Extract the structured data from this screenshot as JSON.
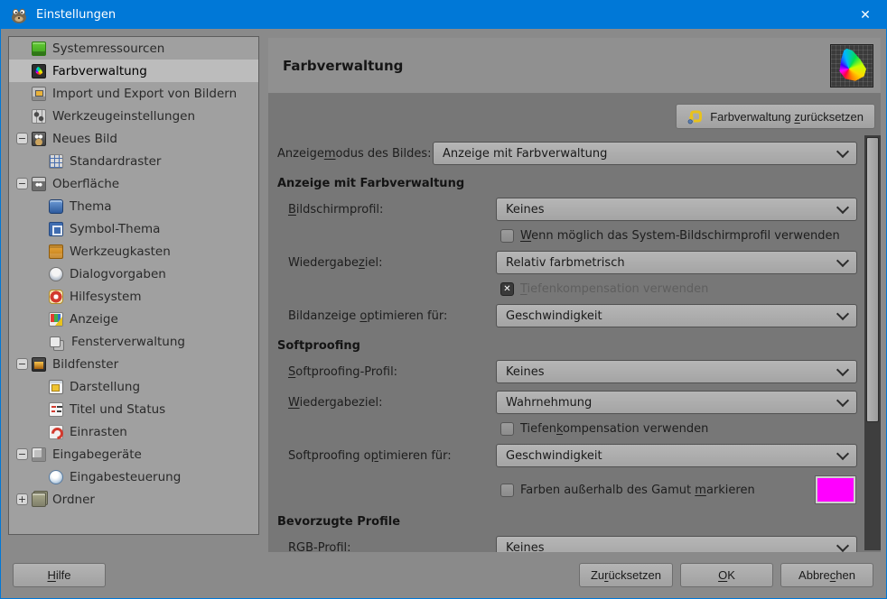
{
  "window": {
    "title": "Einstellungen"
  },
  "icons": {
    "close": "✕",
    "check": "✕",
    "expander_minus": "−",
    "expander_plus": "+"
  },
  "colors": {
    "titlebar": "#0078d7",
    "gamut_warning_swatch": "#ff00ff"
  },
  "sidebar": {
    "items": [
      {
        "label": "Systemressourcen",
        "level": 0,
        "icon": "memory-chip-icon"
      },
      {
        "label": "Farbverwaltung",
        "level": 0,
        "icon": "color-gamut-icon",
        "selected": true
      },
      {
        "label": "Import und Export von Bildern",
        "level": 0,
        "icon": "import-export-icon"
      },
      {
        "label": "Werkzeugeinstellungen",
        "level": 0,
        "icon": "tool-options-icon"
      },
      {
        "label": "Neues Bild",
        "level": 0,
        "expander": "minus",
        "icon": "wilber-new-image-icon"
      },
      {
        "label": "Standardraster",
        "level": 1,
        "icon": "grid-icon"
      },
      {
        "label": "Oberfläche",
        "level": 0,
        "expander": "minus",
        "icon": "interface-icon"
      },
      {
        "label": "Thema",
        "level": 1,
        "icon": "theme-icon"
      },
      {
        "label": "Symbol-Thema",
        "level": 1,
        "icon": "icon-theme-icon"
      },
      {
        "label": "Werkzeugkasten",
        "level": 1,
        "icon": "toolbox-icon"
      },
      {
        "label": "Dialogvorgaben",
        "level": 1,
        "icon": "dialog-defaults-icon"
      },
      {
        "label": "Hilfesystem",
        "level": 1,
        "icon": "help-system-icon"
      },
      {
        "label": "Anzeige",
        "level": 1,
        "icon": "display-icon"
      },
      {
        "label": "Fensterverwaltung",
        "level": 1,
        "icon": "window-management-icon"
      },
      {
        "label": "Bildfenster",
        "level": 0,
        "expander": "minus",
        "icon": "image-window-icon"
      },
      {
        "label": "Darstellung",
        "level": 1,
        "icon": "appearance-icon"
      },
      {
        "label": "Titel und Status",
        "level": 1,
        "icon": "title-status-icon"
      },
      {
        "label": "Einrasten",
        "level": 1,
        "icon": "snapping-icon"
      },
      {
        "label": "Eingabegeräte",
        "level": 0,
        "expander": "minus",
        "icon": "input-devices-icon"
      },
      {
        "label": "Eingabesteuerung",
        "level": 1,
        "icon": "input-controllers-icon"
      },
      {
        "label": "Ordner",
        "level": 0,
        "expander": "plus",
        "icon": "folders-icon"
      }
    ]
  },
  "content": {
    "title": "Farbverwaltung",
    "reset_button": "Farbverwaltung _zurücksetzen",
    "rows": [
      {
        "type": "dropdown",
        "label": "Anzeige_modus des Bildes:",
        "value": "Anzeige mit Farbverwaltung",
        "wide": true
      },
      {
        "type": "section",
        "label": "Anzeige mit Farbverwaltung"
      },
      {
        "type": "dropdown",
        "label": "_Bildschirmprofil:",
        "value": "Keines",
        "indent": true
      },
      {
        "type": "checkbox",
        "label": "_Wenn möglich das System-Bildschirmprofil verwenden",
        "checked": false
      },
      {
        "type": "dropdown",
        "label": "Wiedergabe_ziel:",
        "value": "Relativ farbmetrisch",
        "indent": true
      },
      {
        "type": "checkbox",
        "label": "_Tiefenkompensation verwenden",
        "checked": true,
        "disabled": true
      },
      {
        "type": "dropdown",
        "label": "Bildanzeige _optimieren für:",
        "value": "Geschwindigkeit",
        "indent": true
      },
      {
        "type": "section",
        "label": "Softproofing"
      },
      {
        "type": "dropdown",
        "label": "_Softproofing-Profil:",
        "value": "Keines",
        "indent": true
      },
      {
        "type": "dropdown",
        "label": "_Wiedergabeziel:",
        "value": "Wahrnehmung",
        "indent": true
      },
      {
        "type": "checkbox",
        "label": "Tiefen_kompensation verwenden",
        "checked": false
      },
      {
        "type": "dropdown",
        "label": "Softproofing o_ptimieren für:",
        "value": "Geschwindigkeit",
        "indent": true
      },
      {
        "type": "checkbox",
        "label": "Farben außerhalb des Gamut _markieren",
        "checked": false,
        "swatch": "#ff00ff"
      },
      {
        "type": "section",
        "label": "Bevorzugte Profile"
      },
      {
        "type": "dropdown",
        "label": "_RGB-Profil:",
        "value": "Keines",
        "indent": true
      }
    ]
  },
  "footer": {
    "help": "_Hilfe",
    "reset": "Zu_rücksetzen",
    "ok": "_OK",
    "cancel": "Abbre_chen"
  }
}
